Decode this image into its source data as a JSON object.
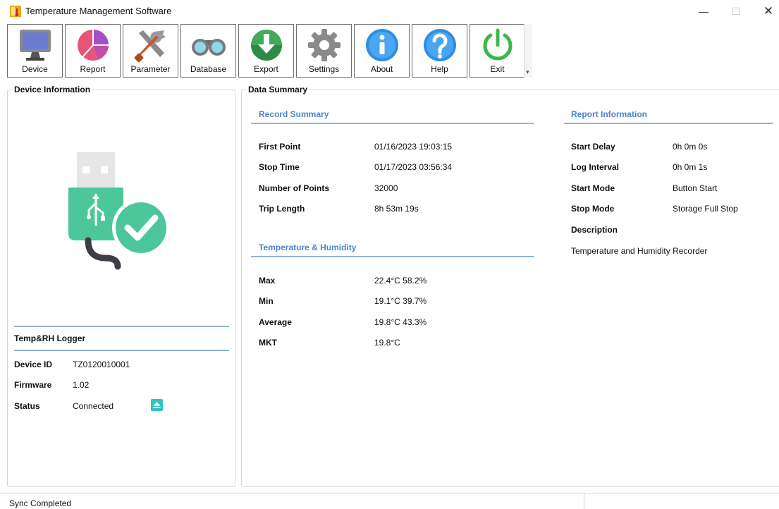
{
  "window": {
    "title": "Temperature Management Software",
    "minimize_glyph": "—",
    "maximize_glyph": "☐",
    "close_glyph": "✕"
  },
  "toolbar": {
    "items": [
      {
        "label": "Device",
        "icon": "monitor-icon"
      },
      {
        "label": "Report",
        "icon": "pie-chart-icon"
      },
      {
        "label": "Parameter",
        "icon": "tools-icon"
      },
      {
        "label": "Database",
        "icon": "binoculars-icon"
      },
      {
        "label": "Export",
        "icon": "export-icon"
      },
      {
        "label": "Settings",
        "icon": "gear-icon"
      },
      {
        "label": "About",
        "icon": "info-icon"
      },
      {
        "label": "Help",
        "icon": "help-icon"
      },
      {
        "label": "Exit",
        "icon": "power-icon"
      }
    ],
    "overflow_glyph": "▾"
  },
  "device_panel": {
    "title": "Device Information",
    "logger_name": "Temp&RH Logger",
    "rows": [
      {
        "label": "Device ID",
        "value": "TZ0120010001"
      },
      {
        "label": "Firmware",
        "value": "1.02"
      },
      {
        "label": "Status",
        "value": "Connected"
      }
    ]
  },
  "summary_panel": {
    "title": "Data Summary",
    "record_summary": {
      "heading": "Record Summary",
      "rows": [
        {
          "label": "First Point",
          "value": "01/16/2023 19:03:15"
        },
        {
          "label": "Stop Time",
          "value": "01/17/2023 03:56:34"
        },
        {
          "label": "Number of Points",
          "value": "32000"
        },
        {
          "label": "Trip Length",
          "value": "8h 53m 19s"
        }
      ]
    },
    "temp_humidity": {
      "heading": "Temperature & Humidity",
      "rows": [
        {
          "label": "Max",
          "value": "22.4°C  58.2%"
        },
        {
          "label": "Min",
          "value": "19.1°C  39.7%"
        },
        {
          "label": "Average",
          "value": "19.8°C  43.3%"
        },
        {
          "label": "MKT",
          "value": "19.8°C"
        }
      ]
    },
    "report_information": {
      "heading": "Report Information",
      "rows": [
        {
          "label": "Start Delay",
          "value": "0h 0m 0s"
        },
        {
          "label": "Log Interval",
          "value": "0h 0m 1s"
        },
        {
          "label": "Start Mode",
          "value": "Button Start"
        },
        {
          "label": "Stop Mode",
          "value": "Storage Full Stop"
        },
        {
          "label": "Description",
          "value": ""
        }
      ],
      "description_text": "Temperature and Humidity Recorder"
    }
  },
  "statusbar": {
    "text": "Sync Completed"
  },
  "colors": {
    "section_heading": "#4a86c8",
    "separator": "#95b3d7",
    "usb_green": "#4cc79b",
    "eject_teal": "#32c3c3"
  }
}
